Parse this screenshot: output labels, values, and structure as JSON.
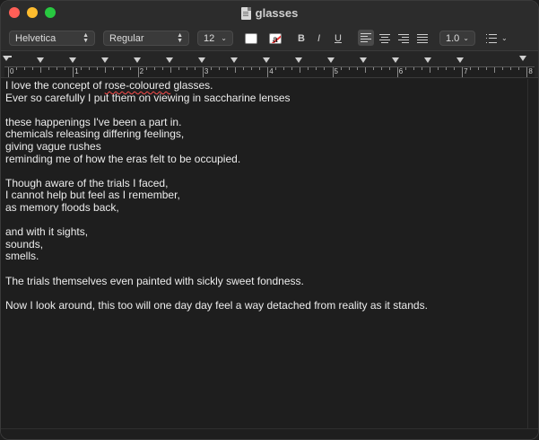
{
  "window": {
    "title": "glasses"
  },
  "toolbar": {
    "font_family": "Helvetica",
    "font_style": "Regular",
    "font_size": "12",
    "bold_label": "B",
    "italic_label": "I",
    "underline_label": "U",
    "line_spacing": "1.0",
    "highlight_glyph": "a"
  },
  "ruler": {
    "numbers": [
      "0",
      "1",
      "2",
      "3",
      "4",
      "5",
      "6",
      "7",
      "8"
    ]
  },
  "document": {
    "lines": [
      {
        "pre": "I love the concept of ",
        "spell": "rose-coloured",
        "post": " glasses."
      },
      {
        "text": "Ever so carefully I put them on viewing in saccharine lenses"
      },
      {
        "text": ""
      },
      {
        "text": "these happenings I've been a part in."
      },
      {
        "text": "chemicals releasing differing feelings,"
      },
      {
        "text": "giving vague rushes"
      },
      {
        "text": "reminding me of how the eras felt to be occupied."
      },
      {
        "text": ""
      },
      {
        "text": "Though aware of the trials I faced,"
      },
      {
        "text": "I cannot help but feel as I remember,"
      },
      {
        "text": "as memory floods back,"
      },
      {
        "text": ""
      },
      {
        "text": "and with it sights,"
      },
      {
        "text": "sounds,"
      },
      {
        "text": "smells."
      },
      {
        "text": ""
      },
      {
        "text": "The trials themselves even painted with sickly sweet fondness."
      },
      {
        "text": ""
      },
      {
        "text": "Now I look around, this too will one day day feel a way detached from reality as it stands."
      }
    ]
  },
  "colors": {
    "close": "#ff5f57",
    "minimize": "#febc2e",
    "maximize": "#28c840",
    "spell_underline": "#ff4d4d"
  }
}
